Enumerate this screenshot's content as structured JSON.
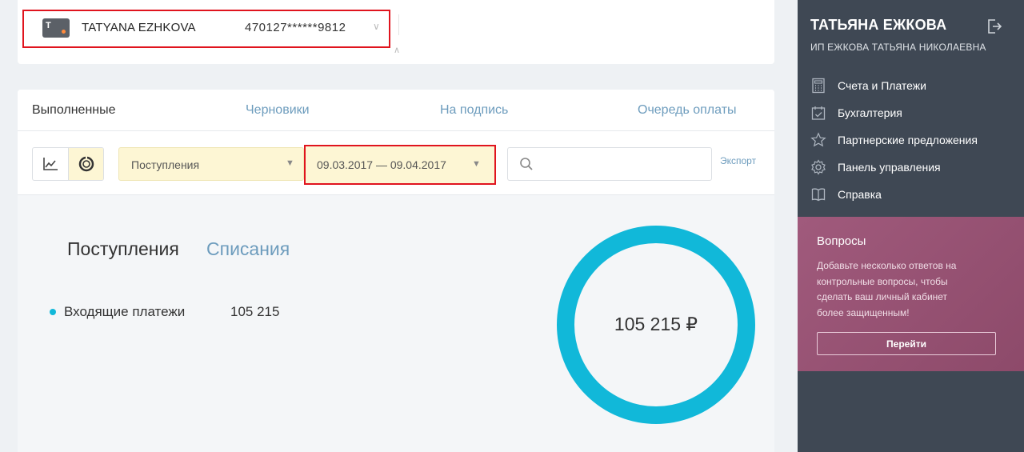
{
  "card": {
    "holder": "TATYANA EZHKOVA",
    "number": "470127******9812",
    "icon_letter": "T"
  },
  "tabs": [
    {
      "label": "Выполненные",
      "active": true
    },
    {
      "label": "Черновики",
      "active": false
    },
    {
      "label": "На подпись",
      "active": false
    },
    {
      "label": "Очередь оплаты",
      "active": false
    }
  ],
  "filters": {
    "type_value": "Поступления",
    "date_value": "09.03.2017 — 09.04.2017",
    "search_placeholder": "",
    "export_label": "Экспорт"
  },
  "summary": {
    "tab_income": "Поступления",
    "tab_outgoing": "Списания",
    "legend": [
      {
        "label": "Входящие платежи",
        "value": "105 215",
        "color": "#11b8d9"
      }
    ],
    "total_label": "105 215 ₽"
  },
  "chart_data": {
    "type": "pie",
    "categories": [
      "Входящие платежи"
    ],
    "values": [
      105215
    ],
    "colors": [
      "#11b8d9"
    ],
    "title": "",
    "center_label": "105 215 ₽"
  },
  "sidebar": {
    "user_name": "ТАТЬЯНА ЕЖКОВА",
    "org": "ИП ЕЖКОВА ТАТЬЯНА НИКОЛАЕВНА",
    "nav": [
      {
        "label": "Счета и Платежи",
        "icon": "calculator-icon"
      },
      {
        "label": "Бухгалтерия",
        "icon": "calendar-icon"
      },
      {
        "label": "Партнерские предложения",
        "icon": "star-icon"
      },
      {
        "label": "Панель управления",
        "icon": "gear-icon"
      },
      {
        "label": "Справка",
        "icon": "book-icon"
      }
    ],
    "promo": {
      "title": "Вопросы",
      "text": "Добавьте несколько ответов на контрольные вопросы, чтобы сделать ваш личный кабинет более защищенным!",
      "button_label": "Перейти"
    }
  },
  "colors": {
    "accent": "#11b8d9",
    "link": "#6d9cbd",
    "sidebar_bg": "#3f4854",
    "promo_bg": "#a05a7c",
    "highlight_yellow": "#fdf6d4"
  }
}
